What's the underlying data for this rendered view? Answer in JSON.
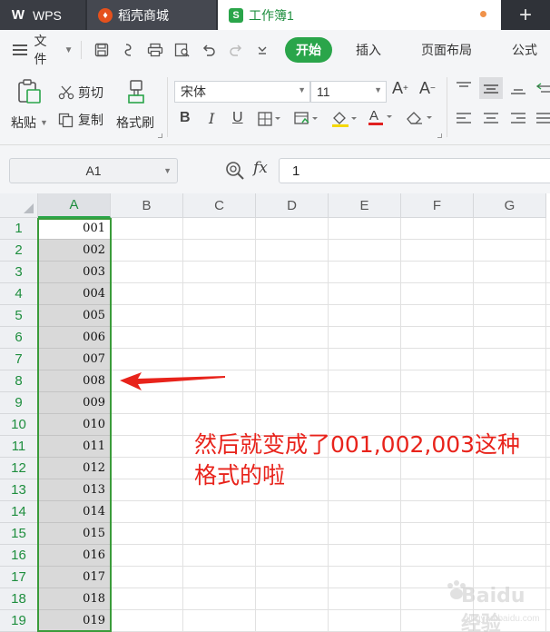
{
  "tabs": {
    "wps": "WPS",
    "store": "稻壳商城",
    "workbook": "工作簿1"
  },
  "menu": {
    "file": "文件",
    "tabs": [
      "开始",
      "插入",
      "页面布局",
      "公式"
    ]
  },
  "ribbon": {
    "paste": "粘贴",
    "cut": "剪切",
    "copy": "复制",
    "format_painter": "格式刷",
    "font_name": "宋体",
    "font_size": "11"
  },
  "formula_bar": {
    "name_box": "A1",
    "fx": "fx",
    "value": "1"
  },
  "grid": {
    "columns": [
      "A",
      "B",
      "C",
      "D",
      "E",
      "F",
      "G"
    ],
    "rows": [
      "1",
      "2",
      "3",
      "4",
      "5",
      "6",
      "7",
      "8",
      "9",
      "10",
      "11",
      "12",
      "13",
      "14",
      "15",
      "16",
      "17",
      "18",
      "19"
    ],
    "col_a_values": [
      "001",
      "002",
      "003",
      "004",
      "005",
      "006",
      "007",
      "008",
      "009",
      "010",
      "011",
      "012",
      "013",
      "014",
      "015",
      "016",
      "017",
      "018",
      "019"
    ]
  },
  "annotation": {
    "line1": "然后就变成了001,002,003这种",
    "line2": "格式的啦"
  },
  "watermark": {
    "brand": "Baidu经验",
    "site": "jingyan.baidu.com"
  },
  "colors": {
    "accent_green": "#2aa54a",
    "annotation_red": "#e8231b",
    "tab_dark": "#2f3238"
  }
}
